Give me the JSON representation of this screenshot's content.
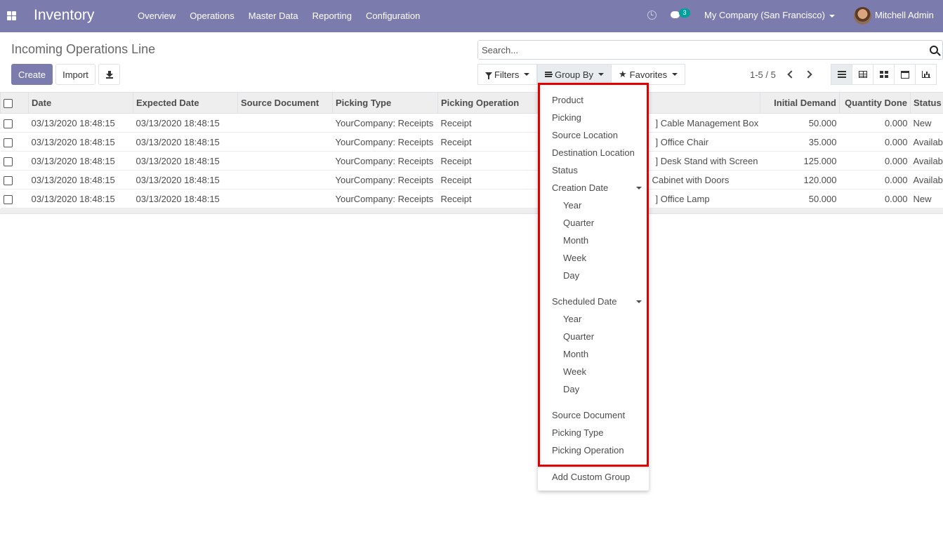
{
  "navbar": {
    "app_title": "Inventory",
    "menu": [
      "Overview",
      "Operations",
      "Master Data",
      "Reporting",
      "Configuration"
    ],
    "chat_count": "3",
    "company": "My Company (San Francisco)",
    "user": "Mitchell Admin",
    "brand_color": "#7c7bad"
  },
  "control": {
    "title": "Incoming Operations Line",
    "create_label": "Create",
    "import_label": "Import",
    "search_placeholder": "Search...",
    "filters_label": "Filters",
    "groupby_label": "Group By",
    "favorites_label": "Favorites",
    "pager": "1-5 / 5"
  },
  "table": {
    "columns": [
      "Date",
      "Expected Date",
      "Source Document",
      "Picking Type",
      "Picking Operation",
      "",
      "Initial Demand",
      "Quantity Done",
      "Status"
    ],
    "rows": [
      [
        "03/13/2020 18:48:15",
        "03/13/2020 18:48:15",
        "",
        "YourCompany: Receipts",
        "Receipt",
        "] Cable Management Box",
        "50.000",
        "0.000",
        "New"
      ],
      [
        "03/13/2020 18:48:15",
        "03/13/2020 18:48:15",
        "",
        "YourCompany: Receipts",
        "Receipt",
        "] Office Chair",
        "35.000",
        "0.000",
        "Available"
      ],
      [
        "03/13/2020 18:48:15",
        "03/13/2020 18:48:15",
        "",
        "YourCompany: Receipts",
        "Receipt",
        "] Desk Stand with Screen",
        "125.000",
        "0.000",
        "Available"
      ],
      [
        "03/13/2020 18:48:15",
        "03/13/2020 18:48:15",
        "",
        "YourCompany: Receipts",
        "Receipt",
        "Cabinet with Doors",
        "120.000",
        "0.000",
        "Available"
      ],
      [
        "03/13/2020 18:48:15",
        "03/13/2020 18:48:15",
        "",
        "YourCompany: Receipts",
        "Receipt",
        "] Office Lamp",
        "50.000",
        "0.000",
        "New"
      ]
    ]
  },
  "groupby_menu": {
    "items": [
      "Product",
      "Picking",
      "Source Location",
      "Destination Location",
      "Status"
    ],
    "creation_date": "Creation Date",
    "creation_options": [
      "Year",
      "Quarter",
      "Month",
      "Week",
      "Day"
    ],
    "scheduled_date": "Scheduled Date",
    "scheduled_options": [
      "Year",
      "Quarter",
      "Month",
      "Week",
      "Day"
    ],
    "more_items": [
      "Source Document",
      "Picking Type",
      "Picking Operation"
    ],
    "custom_group": "Add Custom Group",
    "highlight_color": "#e00000"
  }
}
